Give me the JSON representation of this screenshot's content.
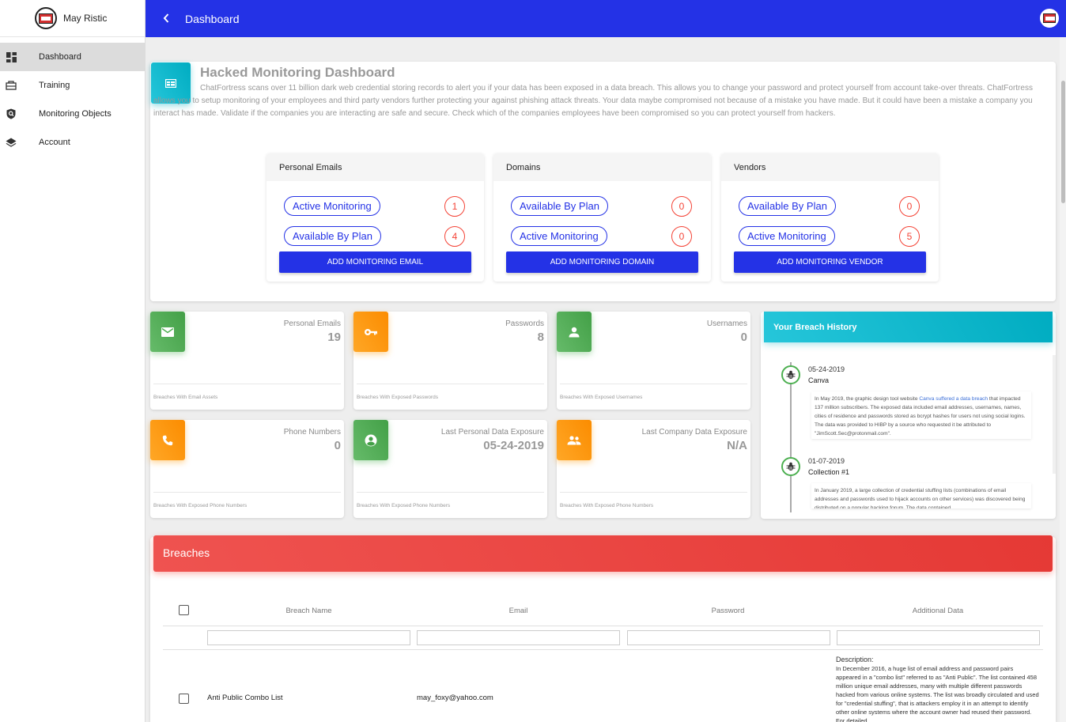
{
  "app": {
    "user_name": "May Ristic",
    "page_title": "Dashboard"
  },
  "sidebar": {
    "items": [
      {
        "label": "Dashboard",
        "icon": "dashboard-icon",
        "active": true
      },
      {
        "label": "Training",
        "icon": "training-icon",
        "active": false
      },
      {
        "label": "Monitoring Objects",
        "icon": "shield-search-icon",
        "active": false
      },
      {
        "label": "Account",
        "icon": "layers-icon",
        "active": false
      }
    ]
  },
  "dashboard": {
    "title": "Hacked Monitoring Dashboard",
    "description": "ChatFortress scans over 11 billion dark web credential storing records to alert you if your data has been exposed in a data breach. This allows you to change your password and protect yourself from account take-over threats. ChatFortress allows you to setup monitoring of your employees and third party vendors further protecting your against phishing attack threats. Your data maybe compromised not because of a mistake you have made. But it could have been a mistake a company you interact has made. Validate if the companies you are interacting are safe and secure. Check which of the companies employees have been compromised so you can protect yourself from hackers.",
    "panels": [
      {
        "title": "Personal Emails",
        "rows": [
          {
            "label": "Active Monitoring",
            "count": "1"
          },
          {
            "label": "Available By Plan",
            "count": "4"
          }
        ],
        "button": "ADD MONITORING EMAIL"
      },
      {
        "title": "Domains",
        "rows": [
          {
            "label": "Available By Plan",
            "count": "0"
          },
          {
            "label": "Active Monitoring",
            "count": "0"
          }
        ],
        "button": "ADD MONITORING DOMAIN"
      },
      {
        "title": "Vendors",
        "rows": [
          {
            "label": "Available By Plan",
            "count": "0"
          },
          {
            "label": "Active Monitoring",
            "count": "5"
          }
        ],
        "button": "ADD MONITORING VENDOR"
      }
    ]
  },
  "stats": [
    {
      "label": "Personal Emails",
      "value": "19",
      "footer": "Breaches With Email Assets",
      "color": "green",
      "icon": "email-icon"
    },
    {
      "label": "Passwords",
      "value": "8",
      "footer": "Breaches With Exposed Passwords",
      "color": "orange",
      "icon": "key-icon"
    },
    {
      "label": "Usernames",
      "value": "0",
      "footer": "Breaches With Exposed Usernames",
      "color": "green",
      "icon": "user-icon"
    },
    {
      "label": "Phone Numbers",
      "value": "0",
      "footer": "Breaches With Exposed Phone Numbers",
      "color": "orange",
      "icon": "phone-icon"
    },
    {
      "label": "Last Personal Data Exposure",
      "value": "05-24-2019",
      "footer": "Breaches With Exposed Phone Numbers",
      "color": "green",
      "icon": "account-circle-icon"
    },
    {
      "label": "Last Company Data Exposure",
      "value": "N/A",
      "footer": "Breaches With Exposed Phone Numbers",
      "color": "orange",
      "icon": "group-icon"
    }
  ],
  "history": {
    "title": "Your Breach History",
    "entries": [
      {
        "date": "05-24-2019",
        "name": "Canva",
        "text_before": "In May 2019, the graphic design tool website ",
        "link": "Canva suffered a data breach",
        "text_after": " that impacted 137 million subscribers. The exposed data included email addresses, usernames, names, cities of residence and passwords stored as bcrypt hashes for users not using social logins. The data was provided to HIBP by a source who requested it be attributed to \"JimScott.Sec@protonmail.com\"."
      },
      {
        "date": "01-07-2019",
        "name": "Collection #1",
        "text_before": "In January 2019, a large collection of credential stuffing lists (combinations of email addresses and passwords used to hijack accounts on other services) was discovered being distributed on a popular hacking forum. The data contained",
        "link": "",
        "text_after": ""
      }
    ]
  },
  "breaches": {
    "title": "Breaches",
    "columns": [
      "Breach Name",
      "Email",
      "Password",
      "Additional Data"
    ],
    "rows": [
      {
        "name": "Anti Public Combo List",
        "email": "may_foxy@yahoo.com",
        "password": "",
        "description_label": "Description:",
        "description": "In December 2016, a huge list of email address and password pairs appeared in a \"combo list\" referred to as \"Anti Public\". The list contained 458 million unique email addresses, many with multiple different passwords hacked from various online systems. The list was broadly circulated and used for \"credential stuffing\", that is attackers employ it in an attempt to identify other online systems where the account owner had reused their password. For detailed"
      }
    ]
  }
}
